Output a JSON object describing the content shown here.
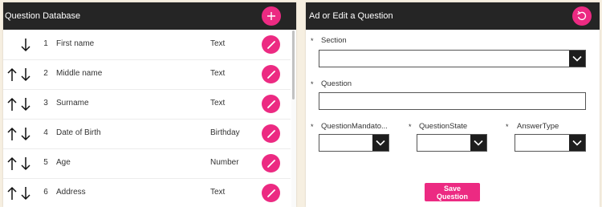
{
  "question_database": {
    "title": "Question Database",
    "add_icon": "plus-icon",
    "rows": [
      {
        "num": "1",
        "name": "First name",
        "type": "Text",
        "up": false,
        "down": true
      },
      {
        "num": "2",
        "name": "Middle name",
        "type": "Text",
        "up": true,
        "down": true
      },
      {
        "num": "3",
        "name": "Surname",
        "type": "Text",
        "up": true,
        "down": true
      },
      {
        "num": "4",
        "name": "Date of Birth",
        "type": "Birthday",
        "up": true,
        "down": true
      },
      {
        "num": "5",
        "name": "Age",
        "type": "Number",
        "up": true,
        "down": true
      },
      {
        "num": "6",
        "name": "Address",
        "type": "Text",
        "up": true,
        "down": true
      }
    ]
  },
  "editor": {
    "title": "Ad or Edit a Question",
    "reset_icon": "undo-icon",
    "required_mark": "*",
    "section_label": "Section",
    "section_value": "",
    "question_label": "Question",
    "question_value": "",
    "mandatory_label": "QuestionMandato...",
    "mandatory_value": "",
    "state_label": "QuestionState",
    "state_value": "",
    "answertype_label": "AnswerType",
    "answertype_value": "",
    "save_label": "Save Question"
  },
  "colors": {
    "accent": "#ec2a82",
    "header_bg": "#252525",
    "page_bg": "#f6efe1"
  }
}
